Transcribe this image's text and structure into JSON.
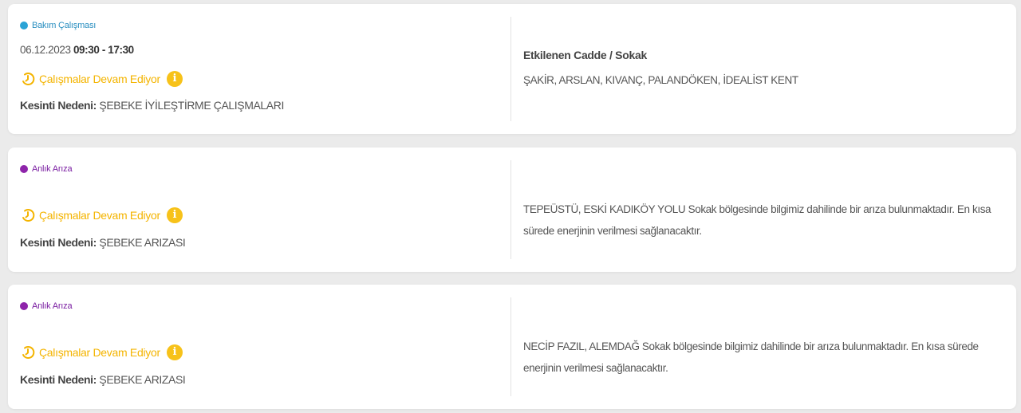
{
  "colors": {
    "maintenance": "#2aa3d6",
    "fault": "#8e24aa",
    "status": "#f4b400",
    "info": "#f7c21a"
  },
  "outages": [
    {
      "type": "Bakım Çalışması",
      "date": "06.12.2023",
      "time": "09:30 - 17:30",
      "status": "Çalışmalar Devam Ediyor",
      "reason_label": "Kesinti Nedeni:",
      "reason": "ŞEBEKE İYİLEŞTİRME ÇALIŞMALARI",
      "streets_title": "Etkilenen Cadde / Sokak",
      "streets": "ŞAKİR, ARSLAN, KIVANÇ, PALANDÖKEN, İDEALİST KENT"
    },
    {
      "type": "Anlık Arıza",
      "status": "Çalışmalar Devam Ediyor",
      "reason_label": "Kesinti Nedeni:",
      "reason": "ŞEBEKE ARIZASI",
      "description": "TEPEÜSTÜ, ESKİ KADIKÖY YOLU Sokak bölgesinde bilgimiz dahilinde bir arıza bulunmaktadır. En kısa sürede enerjinin verilmesi sağlanacaktır."
    },
    {
      "type": "Anlık Arıza",
      "status": "Çalışmalar Devam Ediyor",
      "reason_label": "Kesinti Nedeni:",
      "reason": "ŞEBEKE ARIZASI",
      "description": "NECİP FAZIL, ALEMDAĞ Sokak bölgesinde bilgimiz dahilinde bir arıza bulunmaktadır. En kısa sürede enerjinin verilmesi sağlanacaktır."
    }
  ]
}
